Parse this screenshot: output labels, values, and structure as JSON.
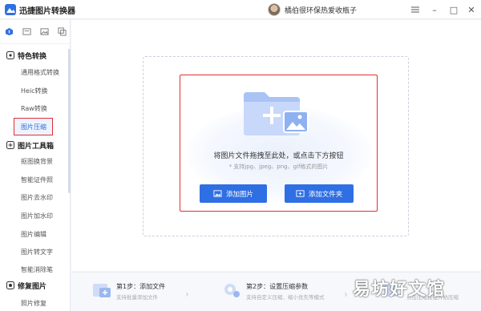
{
  "app": {
    "title": "迅捷图片转换器"
  },
  "user": {
    "name": "橘伯很环保热爱收瓶子"
  },
  "window": {
    "menu_icon": "menu-icon",
    "minimize_label": "–",
    "maximize_label": "□",
    "close_label": "✕"
  },
  "sidebar": {
    "tools": [
      "home-icon",
      "image-icon",
      "picture-icon",
      "layers-icon"
    ],
    "groups": [
      {
        "title": "特色转换",
        "icon": "star-icon",
        "items": [
          "通用格式转换",
          "Heic转换",
          "Raw转换",
          "图片压缩"
        ]
      },
      {
        "title": "图片工具箱",
        "icon": "toolbox-icon",
        "items": [
          "抠图换背景",
          "智能证件照",
          "图片去水印",
          "图片加水印",
          "图片编辑",
          "图片转文字",
          "智能消除笔"
        ]
      },
      {
        "title": "修复图片",
        "icon": "repair-icon",
        "items": [
          "照片修复"
        ]
      }
    ],
    "active_item": "图片压缩"
  },
  "dropzone": {
    "title": "将图片文件拖拽至此处，或点击下方按钮",
    "hint": "* 支持jpg、jpeg、png、gif格式的图片",
    "add_image_label": "添加图片",
    "add_folder_label": "添加文件夹"
  },
  "steps": [
    {
      "title": "第1步：添加文件",
      "desc": "支持批量添加文件"
    },
    {
      "title": "第2步：设置压缩参数",
      "desc": "支持自定义压缩、缩小优先等模式"
    },
    {
      "title": "",
      "desc": "点击压缩按钮开始压缩"
    }
  ],
  "watermark": "易坊好文馆",
  "colors": {
    "accent": "#2f6fe4",
    "highlight_border": "#e03030"
  }
}
